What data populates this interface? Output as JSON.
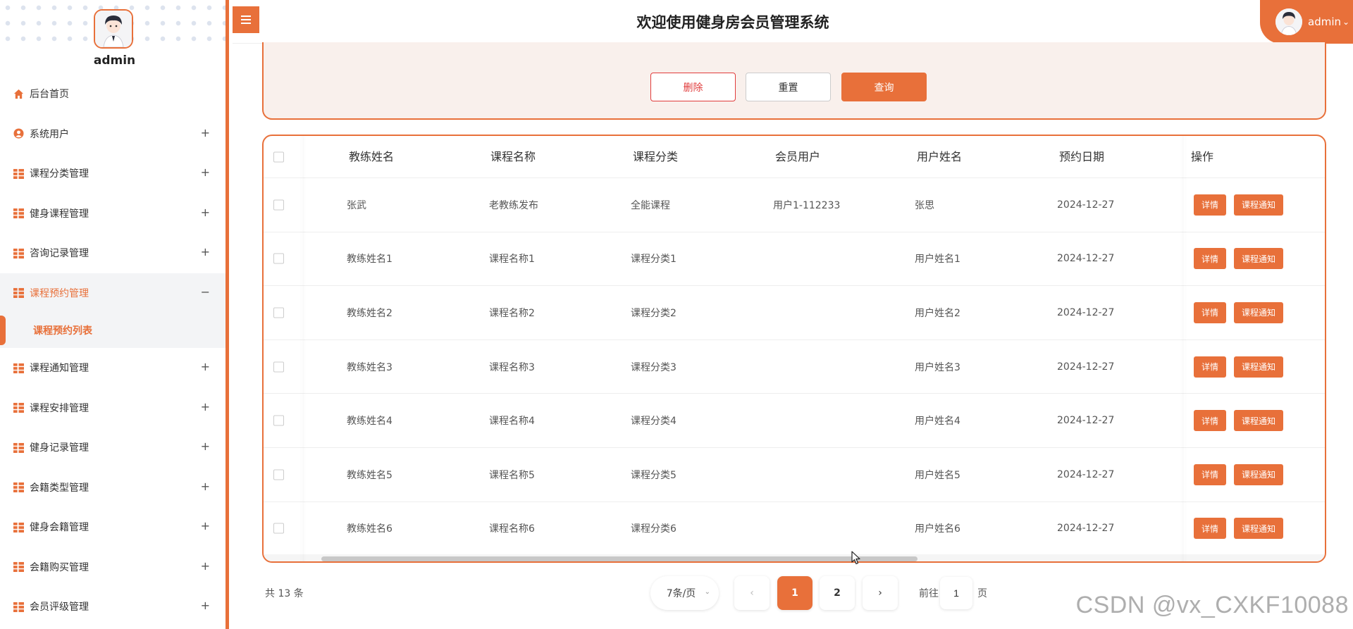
{
  "header": {
    "title": "欢迎使用健身房会员管理系统",
    "user_name": "admin",
    "user_caret": "⌄"
  },
  "sidebar": {
    "user_name": "admin",
    "items": [
      {
        "label": "后台首页",
        "icon": "home-icon",
        "toggle": ""
      },
      {
        "label": "系统用户",
        "icon": "user-icon",
        "toggle": "+"
      },
      {
        "label": "课程分类管理",
        "icon": "grid-icon",
        "toggle": "+"
      },
      {
        "label": "健身课程管理",
        "icon": "grid-icon",
        "toggle": "+"
      },
      {
        "label": "咨询记录管理",
        "icon": "grid-icon",
        "toggle": "+"
      },
      {
        "label": "课程预约管理",
        "icon": "grid-icon",
        "toggle": "−"
      },
      {
        "label": "课程通知管理",
        "icon": "grid-icon",
        "toggle": "+"
      },
      {
        "label": "课程安排管理",
        "icon": "grid-icon",
        "toggle": "+"
      },
      {
        "label": "健身记录管理",
        "icon": "grid-icon",
        "toggle": "+"
      },
      {
        "label": "会籍类型管理",
        "icon": "grid-icon",
        "toggle": "+"
      },
      {
        "label": "健身会籍管理",
        "icon": "grid-icon",
        "toggle": "+"
      },
      {
        "label": "会籍购买管理",
        "icon": "grid-icon",
        "toggle": "+"
      },
      {
        "label": "会员评级管理",
        "icon": "grid-icon",
        "toggle": "+"
      }
    ],
    "active_sub": "课程预约列表"
  },
  "search": {
    "delete_label": "删除",
    "reset_label": "重置",
    "query_label": "查询"
  },
  "table": {
    "columns": [
      "教练姓名",
      "课程名称",
      "课程分类",
      "会员用户",
      "用户姓名",
      "预约日期",
      "操作"
    ],
    "rows": [
      [
        "张武",
        "老教练发布",
        "全能课程",
        "用户1-112233",
        "张思",
        "2024-12-27"
      ],
      [
        "教练姓名1",
        "课程名称1",
        "课程分类1",
        "",
        "用户姓名1",
        "2024-12-27"
      ],
      [
        "教练姓名2",
        "课程名称2",
        "课程分类2",
        "",
        "用户姓名2",
        "2024-12-27"
      ],
      [
        "教练姓名3",
        "课程名称3",
        "课程分类3",
        "",
        "用户姓名3",
        "2024-12-27"
      ],
      [
        "教练姓名4",
        "课程名称4",
        "课程分类4",
        "",
        "用户姓名4",
        "2024-12-27"
      ],
      [
        "教练姓名5",
        "课程名称5",
        "课程分类5",
        "",
        "用户姓名5",
        "2024-12-27"
      ],
      [
        "教练姓名6",
        "课程名称6",
        "课程分类6",
        "",
        "用户姓名6",
        "2024-12-27"
      ]
    ],
    "detail_label": "详情",
    "notice_label": "课程通知"
  },
  "pagination": {
    "total_text": "共 13 条",
    "page_size": "7条/页",
    "prev": "‹",
    "pages": [
      "1",
      "2"
    ],
    "next": "›",
    "goto_label": "前往",
    "goto_value": "1",
    "goto_unit": "页"
  },
  "watermark": "CSDN @vx_CXKF10088",
  "colors": {
    "accent": "#e8703a",
    "danger": "#e03c3c",
    "panel_bg": "#f9f0ec"
  }
}
